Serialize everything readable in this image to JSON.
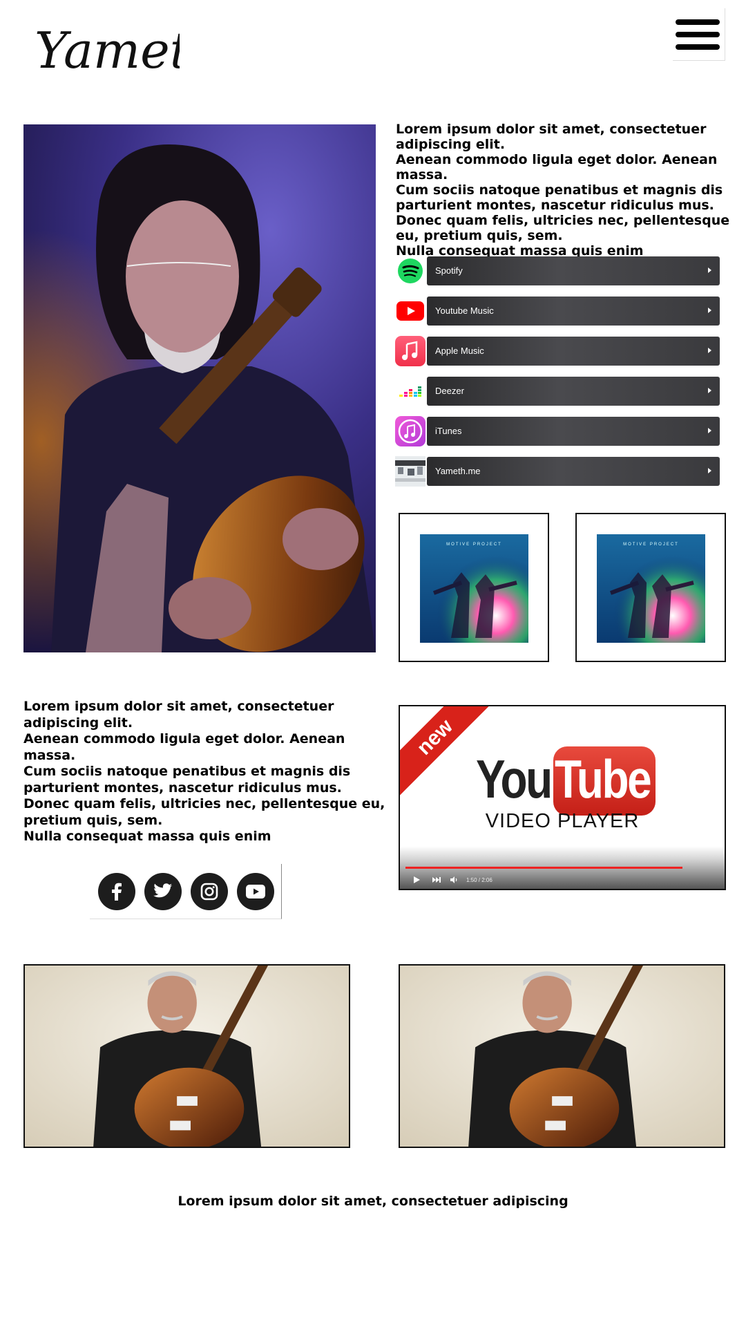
{
  "header": {
    "logo_text": "Yameth",
    "menu_icon": "hamburger-menu-icon"
  },
  "intro": {
    "text": "Lorem ipsum dolor sit amet, consectetuer adipiscing elit.\nAenean commodo ligula eget dolor. Aenean massa.\nCum sociis natoque penatibus et magnis dis parturient montes, nascetur ridiculus mus.\nDonec quam felis, ultricies nec, pellentesque eu, pretium quis, sem.\n Nulla consequat massa quis enim"
  },
  "streaming_links": [
    {
      "label": "Spotify",
      "icon": "spotify-icon"
    },
    {
      "label": "Youtube Music",
      "icon": "youtube-music-icon"
    },
    {
      "label": "Apple Music",
      "icon": "apple-music-icon"
    },
    {
      "label": "Deezer",
      "icon": "deezer-icon"
    },
    {
      "label": "iTunes",
      "icon": "itunes-icon"
    },
    {
      "label": "Yameth.me",
      "icon": "yameth-site-icon"
    }
  ],
  "albums": [
    {
      "cover_text": "MOTIVE PROJECT"
    },
    {
      "cover_text": "MOTIVE PROJECT"
    }
  ],
  "about": {
    "text": "Lorem ipsum dolor sit amet, consectetuer adipiscing elit.\nAenean commodo ligula eget dolor. Aenean massa.\nCum sociis natoque penatibus et magnis dis parturient montes, nascetur ridiculus mus.\nDonec quam felis, ultricies nec, pellentesque eu, pretium quis, sem.\n Nulla consequat massa quis enim"
  },
  "social_links": [
    {
      "icon": "facebook-icon"
    },
    {
      "icon": "twitter-icon"
    },
    {
      "icon": "instagram-icon"
    },
    {
      "icon": "youtube-icon"
    }
  ],
  "video": {
    "ribbon": "new",
    "brand_you": "You",
    "brand_tube": "Tube",
    "subtitle": "VIDEO PLAYER",
    "time": "1:50 / 2:06",
    "progress": 0.87
  },
  "footer": {
    "text": "Lorem ipsum dolor sit amet, consectetuer adipiscing"
  },
  "colors": {
    "accent_red": "#d8221a",
    "stream_bar": "#3a3a3d",
    "social_circle": "#1d1d1d",
    "spotify_green": "#1ed760"
  }
}
